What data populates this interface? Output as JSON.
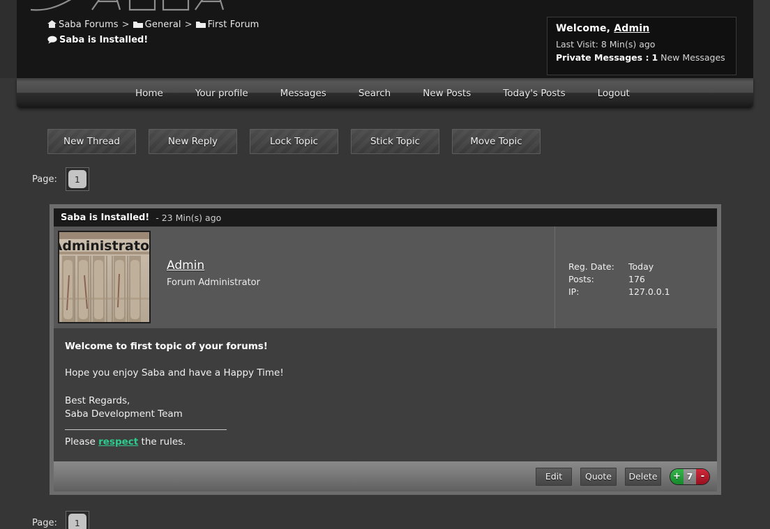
{
  "site": {
    "logo_text": "SABA"
  },
  "breadcrumb": {
    "home_icon": "home-icon",
    "items": [
      {
        "label": "Saba Forums",
        "icon": "home-icon"
      },
      {
        "label": "General",
        "icon": "folder-icon"
      },
      {
        "label": "First Forum",
        "icon": "folder-icon"
      }
    ],
    "separator": ">",
    "topic_icon": "speech-bubble-icon",
    "topic": "Saba is Installed!"
  },
  "welcome": {
    "greeting": "Welcome,",
    "username": "Admin",
    "last_visit_label": "Last Visit:",
    "last_visit_value": "8 Min(s) ago",
    "pm_label": "Private Messages :",
    "pm_count": "1",
    "pm_suffix": "New Messages"
  },
  "nav": {
    "items": [
      {
        "label": "Home"
      },
      {
        "label": "Your profile"
      },
      {
        "label": "Messages"
      },
      {
        "label": "Search"
      },
      {
        "label": "New Posts"
      },
      {
        "label": "Today's Posts"
      },
      {
        "label": "Logout"
      }
    ]
  },
  "toolbar": {
    "buttons": [
      {
        "label": "New Thread"
      },
      {
        "label": "New Reply"
      },
      {
        "label": "Lock Topic"
      },
      {
        "label": "Stick Topic"
      },
      {
        "label": "Move Topic"
      }
    ]
  },
  "pagination": {
    "label": "Page:",
    "current": "1"
  },
  "post": {
    "title": "Saba is Installed!",
    "time": "- 23 Min(s) ago",
    "avatar_caption": "Administrator",
    "author": "Admin",
    "rank": "Forum Administrator",
    "stats": [
      {
        "key": "Reg. Date:",
        "value": "Today"
      },
      {
        "key": "Posts:",
        "value": "176"
      },
      {
        "key": "IP:",
        "value": "127.0.0.1"
      }
    ],
    "body": {
      "heading": "Welcome to first topic of your forums!",
      "paragraph": "Hope you enjoy Saba and have a Happy Time!",
      "sign_off_1": "Best Regards,",
      "sign_off_2": "Saba Development Team",
      "rules_pre": "Please ",
      "rules_link": "respect",
      "rules_post": " the rules."
    },
    "actions": [
      {
        "label": "Edit"
      },
      {
        "label": "Quote"
      },
      {
        "label": "Delete"
      }
    ],
    "rating": {
      "plus": "+",
      "score": "7",
      "minus": "-"
    }
  },
  "colors": {
    "page_bg": "#363636",
    "header_bg": "#161616",
    "post_userrow_bg": "#575757",
    "post_body_bg": "#3e3e3e",
    "link_green": "#2ecb8f",
    "rate_plus_green": "#17882c",
    "rate_minus_red": "#97101f"
  }
}
